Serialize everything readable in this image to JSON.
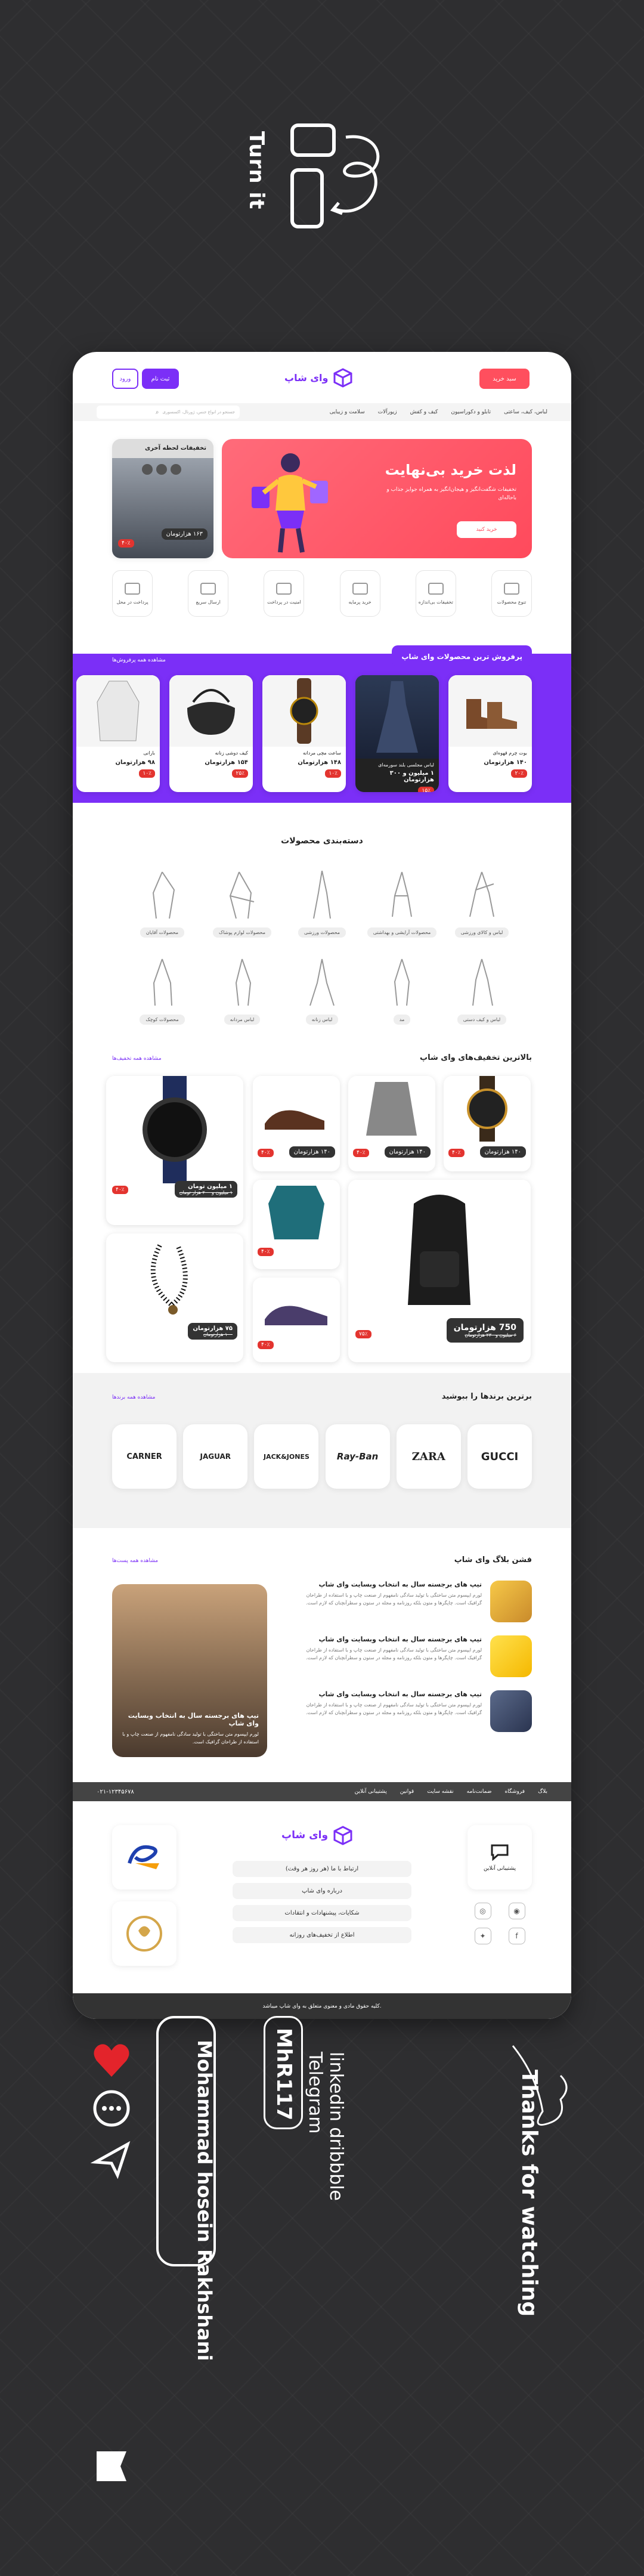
{
  "intro": {
    "turn_text": "Turn it"
  },
  "header": {
    "logo": "وای شاپ",
    "signup": "ثبت نام",
    "login": "ورود",
    "cart": "سبد خرید"
  },
  "nav": {
    "items": [
      "لباس، کیف، ساعتی",
      "تابلو و دکوراسیون",
      "کیف و کفش",
      "زیورآلات",
      "سلامت و زیبایی"
    ],
    "search_placeholder": "جستجو در انواع جنس، ژورنال، اکسسوری"
  },
  "hero": {
    "title": "لذت خرید بی‌نهایت",
    "subtitle": "تخفیفات شگفت‌انگیز و هیجان‌انگیز به همراه جوایز جذاب و باحاله‌ای",
    "button": "خرید کنید"
  },
  "promo": {
    "title": "تخفیفات لحظه آخری",
    "price": "۱۶۳ هزارتومان",
    "off": "۴۰٪"
  },
  "features": [
    "تنوع محصولات",
    "تخفیفات بی‌اندازه",
    "خرید پرمایه",
    "امنیت در پرداخت",
    "ارسال سریع",
    "پرداخت در محل"
  ],
  "bestsellers": {
    "title": "پرفروش ترین محصولات وای شاپ",
    "see_all": "مشاهده همه پرفروش‌ها",
    "products": [
      {
        "name": "بوت چرم قهوه‌ای",
        "price": "۱۴۰ هزارتومان",
        "off": "۲۰٪"
      },
      {
        "name": "لباس مجلسی بلند سورمه‌ای",
        "price": "۱ میلیون و ۳۰۰ هزارتومان",
        "off": "۱۵٪"
      },
      {
        "name": "ساعت مچی مردانه",
        "price": "۱۴۸ هزارتومان",
        "off": "۱۰٪"
      },
      {
        "name": "کیف دوشی زنانه",
        "price": "۱۵۴ هزارتومان",
        "off": "۲۵٪"
      },
      {
        "name": "بارانی",
        "price": "۹۸ هزارتومان",
        "off": "۱۰٪"
      }
    ]
  },
  "categories": {
    "title": "دسته‌بندی محصولات",
    "items": [
      "لباس و کالای ورزشی",
      "محصولات آرایشی و بهداشتی",
      "محصولات ورزشی",
      "محصولات لوازم پوشاک",
      "محصولات آقایان",
      "لباس و کیف دستی",
      "مد",
      "لباس زنانه",
      "لباس مردانه",
      "محصولات کوچک"
    ]
  },
  "discounts": {
    "title": "بالاترین تخفیف‌های وای شاپ",
    "see_all": "مشاهده همه تخفیف‌ها",
    "big_price": "750 هزارتومان",
    "big_old": "۶ میلیون و ۲۳۰ هزارتومان",
    "watch_price": "۱ میلیون تومان",
    "watch_old": "۱ میلیون و ۲۰۰ هزار تومان",
    "beads_price": "۷۵ هزارتومان",
    "beads_old": "۱۰۰ هزارتومان",
    "small_price": "۱۴۰ هزارتومان",
    "off_big": "۷۵٪",
    "off_small": "۴۰٪"
  },
  "brands": {
    "title": "برترین برندها را ببوشید",
    "see_all": "مشاهده همه برندها",
    "items": [
      "GUCCI",
      "ZARA",
      "Ray-Ban",
      "JACK&JONES",
      "JAGUAR",
      "CARNER"
    ]
  },
  "blog": {
    "title": "فشن بلاگ وای شاپ",
    "see_all": "مشاهده همه پست‌ها",
    "post_title": "تیپ های برجسته سال به انتخاب وبسایت وای شاپ",
    "post_text": "لورم ایپسوم متن ساختگی با تولید سادگی نامفهوم از صنعت چاپ و با استفاده از طراحان گرافیک است. چاپگرها و متون بلکه روزنامه و مجله در ستون و سطرآنچنان که لازم است.",
    "feature_title": "تیپ های برجسته سال به انتخاب وبسایت وای شاپ",
    "feature_text": "لورم ایپسوم متن ساختگی با تولید سادگی نامفهوم از صنعت چاپ و با استفاده از طراحان گرافیک است."
  },
  "footer_nav": {
    "items": [
      "بلاگ",
      "فروشگاه",
      "ضمانت‌نامه",
      "نقشه سایت",
      "قوانین",
      "پشتیبانی آنلاین"
    ],
    "phone": "۰۲۱-۱۲۳۴۵۶۷۸"
  },
  "footer": {
    "logo": "وای شاپ",
    "support": "پشتیبانی آنلاین",
    "links": [
      "ارتباط با ما (هر روز هر وقت)",
      "درباره وای شاپ",
      "شکایات، پیشنهادات و انتقادات",
      "اطلاع از تخفیف‌های روزانه"
    ],
    "copyright": "کلیه حقوق مادی و معنوی متعلق به وای شاپ میباشد."
  },
  "credits": {
    "thanks": "Thanks for watching",
    "author": "Mohammad hosein Rakhshani",
    "handle": "MhR117",
    "links": "linkedin dribbble Telegram"
  },
  "colors": {
    "accent": "#7b2ff7",
    "hero": "#ff5a6e",
    "sale": "#e3342f"
  }
}
